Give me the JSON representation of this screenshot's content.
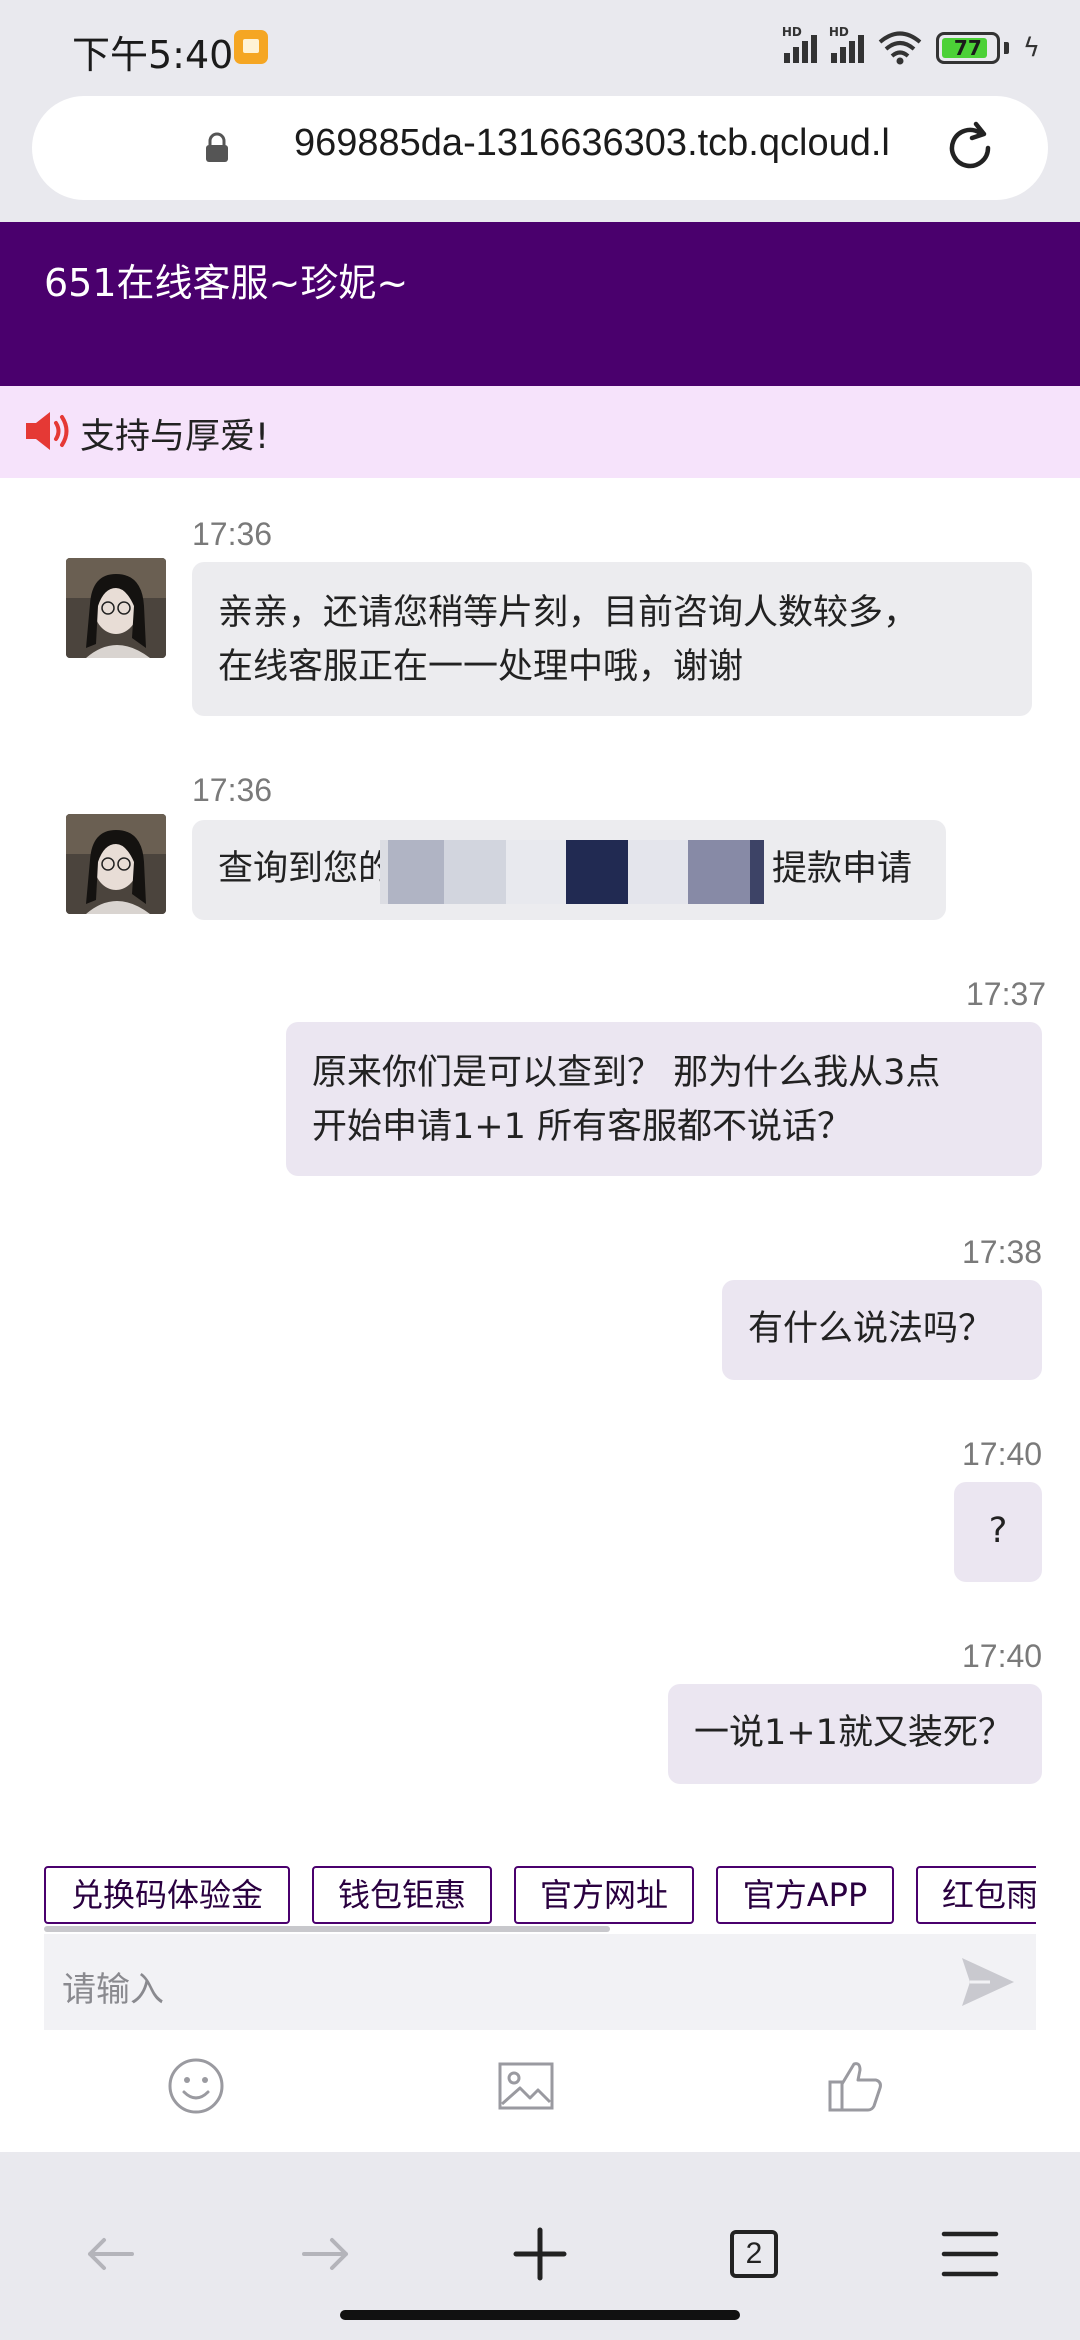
{
  "status_bar": {
    "time": "下午5:40",
    "battery": "77"
  },
  "browser": {
    "url": "969885da-1316636303.tcb.qcloud.l"
  },
  "chat": {
    "title": "651在线客服~珍妮~",
    "notice": "支持与厚爱!",
    "messages": [
      {
        "side": "left",
        "time": "17:36",
        "text_line1": "亲亲，还请您稍等片刻，目前咨询人数较多，",
        "text_line2": "在线客服正在一一处理中哦，谢谢"
      },
      {
        "side": "left",
        "time": "17:36",
        "text_start": "查询到您的",
        "text_end": "提款申请"
      },
      {
        "side": "right",
        "time": "17:37",
        "text_line1": "原来你们是可以查到？ 那为什么我从3点",
        "text_line2": "开始申请1+1 所有客服都不说话？"
      },
      {
        "side": "right",
        "time": "17:38",
        "text": "有什么说法吗？"
      },
      {
        "side": "right",
        "time": "17:40",
        "text": "?"
      },
      {
        "side": "right",
        "time": "17:40",
        "text": "一说1+1就又装死？"
      }
    ]
  },
  "quick_replies": [
    "兑换码体验金",
    "钱包钜惠",
    "官方网址",
    "官方APP",
    "红包雨"
  ],
  "input": {
    "placeholder": "请输入"
  },
  "tabs": {
    "count": "2"
  },
  "colors": {
    "header": "#4a006d",
    "notice_bg": "#f6e3fb",
    "left_bubble": "#ececef",
    "right_bubble": "#ebe6f1"
  },
  "icons": [
    "lock-icon",
    "reload-icon",
    "speaker-icon",
    "send-icon",
    "emoji-icon",
    "image-icon",
    "thumbs-up-icon",
    "back-arrow-icon",
    "forward-arrow-icon",
    "new-tab-icon",
    "tabs-icon",
    "menu-icon"
  ]
}
